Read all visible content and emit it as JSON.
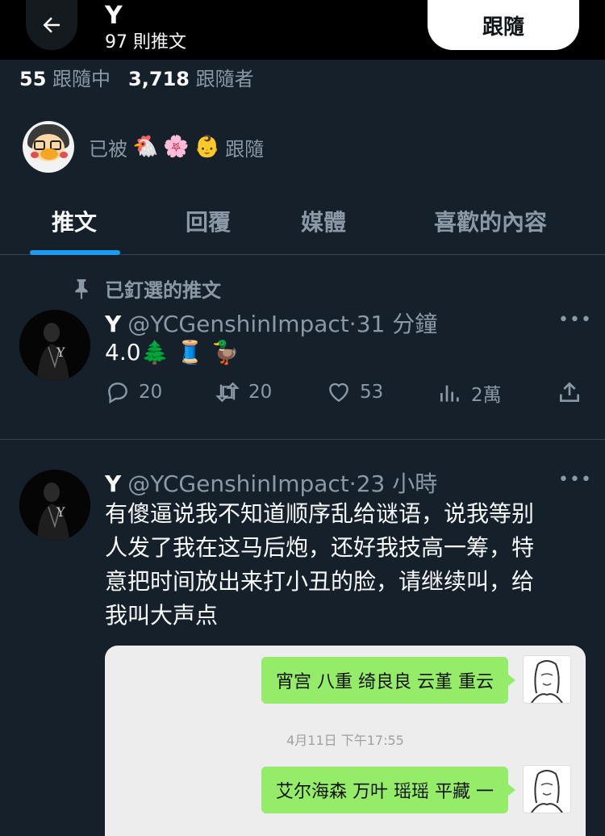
{
  "header": {
    "name": "Y",
    "tweet_count": "97 則推文",
    "follow_label": "跟隨"
  },
  "stats": {
    "following_count": "55",
    "following_label": "跟隨中",
    "followers_count": "3,718",
    "followers_label": "跟隨者"
  },
  "followed_by": {
    "prefix": "已被",
    "emojis": [
      "🐔",
      "🌸",
      "👶"
    ],
    "suffix": "跟隨"
  },
  "tabs": [
    {
      "label": "推文",
      "active": true
    },
    {
      "label": "回覆",
      "active": false
    },
    {
      "label": "媒體",
      "active": false
    },
    {
      "label": "喜歡的內容",
      "active": false
    }
  ],
  "pinned_label": "已釘選的推文",
  "tweets": [
    {
      "name": "Y",
      "handle": "@YCGenshinImpact",
      "time": "31 分鐘",
      "text": "4.0🌲 🧵 🦆",
      "replies": "20",
      "retweets": "20",
      "likes": "53",
      "views": "2萬"
    },
    {
      "name": "Y",
      "handle": "@YCGenshinImpact",
      "time": "23 小時",
      "text_lines": [
        "有傻逼说我不知道顺序乱给谜语，说我等别",
        "人发了我在这马后炮，还好我技高一筹，特",
        "意把时间放出来打小丑的脸，请继续叫，给",
        "我叫大声点"
      ],
      "chat": {
        "bubble1": "宵宫 八重 绮良良 云堇 重云",
        "timestamp": "4月11日 下午17:55",
        "bubble2": "艾尔海森 万叶 瑶瑶 平藏 一"
      }
    }
  ],
  "colors": {
    "background": "#15202b",
    "accent": "#1d9bf0",
    "muted": "#8b98a5",
    "bubble": "#95ec69"
  }
}
